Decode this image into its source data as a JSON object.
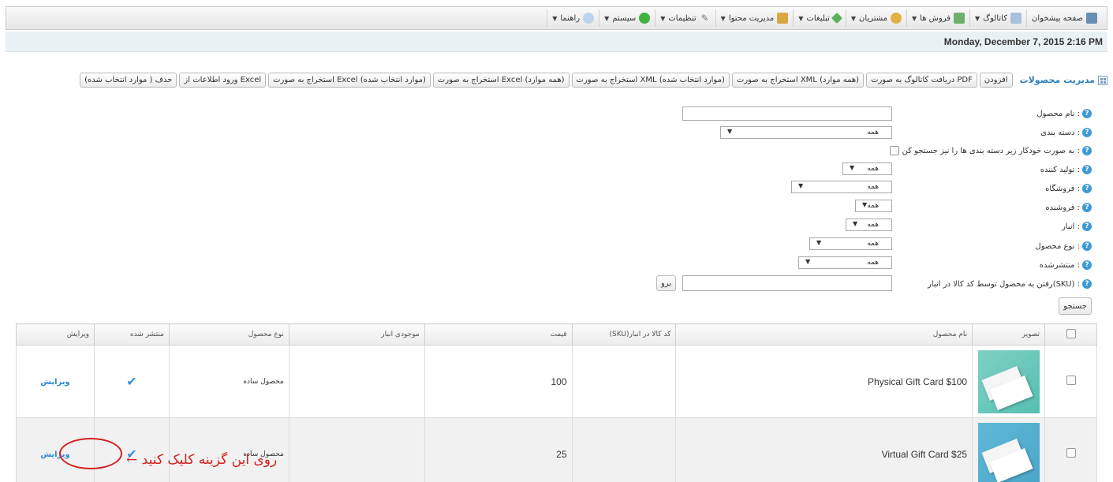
{
  "menu": [
    {
      "label": "صفحه پیشخوان",
      "icon": "dashboard-icon",
      "color": "#6a8fb5",
      "arrow": ""
    },
    {
      "label": "کاتالوگ",
      "icon": "catalog-icon",
      "color": "#7aa0c8",
      "arrow": "▼"
    },
    {
      "label": "فروش ها",
      "icon": "sales-icon",
      "color": "#6db06d",
      "arrow": "▼"
    },
    {
      "label": "مشتریان",
      "icon": "customers-icon",
      "color": "#e0b040",
      "arrow": "▼"
    },
    {
      "label": "تبلیغات",
      "icon": "promotions-icon",
      "color": "#5bb05b",
      "arrow": "▼"
    },
    {
      "label": "مدیریت محتوا",
      "icon": "folder-icon",
      "color": "#d9a640",
      "arrow": "▼"
    },
    {
      "label": "تنظیمات",
      "icon": "wrench-icon",
      "color": "#8a8a8a",
      "arrow": "▼"
    },
    {
      "label": "سیستم",
      "icon": "system-icon",
      "color": "#3fb23f",
      "arrow": "▼"
    },
    {
      "label": "راهنما",
      "icon": "help-chat-icon",
      "color": "#6aa0d8",
      "arrow": "▼"
    }
  ],
  "datetime": "Monday, December 7, 2015 2:16 PM",
  "toolbar": {
    "title": "مدیریت محصولات",
    "buttons": [
      "افزودن",
      "دریافت کاتالوگ به صورت PDF",
      "استخراج به صورت XML (همه موارد)",
      "استخراج به صورت XML (موارد انتخاب شده)",
      "استخراج به صورت Excel (همه موارد)",
      "استخراج به صورت Excel (موارد انتخاب شده)",
      "ورود اطلاعات از Excel",
      "حذف ( موارد انتخاب شده)"
    ]
  },
  "filters": {
    "product_name": "نام محصول :",
    "category": "دسته بندی :",
    "category_value": "همه",
    "subcategories": "به صورت خودکار زیر دسته بندی ها را نیز جستجو کن :",
    "manufacturer": "تولید کننده :",
    "manufacturer_value": "همه",
    "store": "فروشگاه :",
    "store_value": "همه",
    "vendor": "فروشنده :",
    "vendor_value": "همه",
    "warehouse": "انبار :",
    "warehouse_value": "همه",
    "product_type": "نوع محصول :",
    "product_type_value": "همه",
    "published": "منتشرشده :",
    "published_value": "همه",
    "sku": "رفتن به محصول توسط کد کالا در انبار(SKU) :",
    "go": "برو",
    "search": "جستجو"
  },
  "table": {
    "headers": {
      "picture": "تصویر",
      "name": "نام محصول",
      "sku": "کد کالا در انبار(SKU)",
      "price": "قیمت",
      "stock": "موجودی انبار",
      "type": "نوع محصول",
      "published": "منتشر شده",
      "edit": "ویرایش"
    },
    "rows": [
      {
        "name": "Physical Gift Card $100",
        "sku": "",
        "price": "100",
        "stock": "",
        "type": "محصول ساده",
        "published": "✔",
        "edit": "ویرایش"
      },
      {
        "name": "Virtual Gift Card $25",
        "sku": "",
        "price": "25",
        "stock": "",
        "type": "محصول ساده",
        "published": "✔",
        "edit": "ویرایش"
      }
    ]
  },
  "annotation": {
    "text": "روی این گزینه کلیک کنید ←",
    "color": "#d42020"
  }
}
